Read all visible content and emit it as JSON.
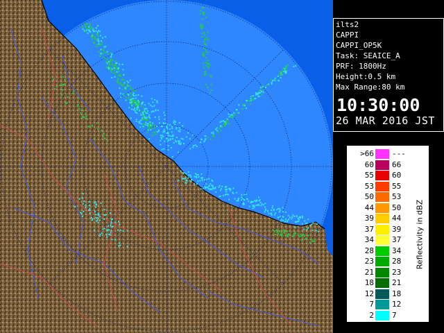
{
  "info": {
    "lines": [
      "ilts2",
      "CAPPI",
      "CAPPI_OP5K",
      "Task: SEAICE_A",
      "PRF: 1800Hz",
      "Height:0.5 km",
      "Max Range:80 km"
    ],
    "time": "10:30:00",
    "date": "26 MAR 2016 JST"
  },
  "legend": {
    "title": "Reflectivity in dBZ",
    "rows": [
      {
        "lo": ">66",
        "hi": "---",
        "color": "#ff33ff"
      },
      {
        "lo": "60",
        "hi": "66",
        "color": "#b8005c"
      },
      {
        "lo": "55",
        "hi": "60",
        "color": "#e60000"
      },
      {
        "lo": "53",
        "hi": "55",
        "color": "#ff3b00"
      },
      {
        "lo": "50",
        "hi": "53",
        "color": "#ff6a00"
      },
      {
        "lo": "44",
        "hi": "50",
        "color": "#ff9900"
      },
      {
        "lo": "39",
        "hi": "44",
        "color": "#ffcc00"
      },
      {
        "lo": "37",
        "hi": "39",
        "color": "#ffee00"
      },
      {
        "lo": "34",
        "hi": "37",
        "color": "#ffff33"
      },
      {
        "lo": "28",
        "hi": "34",
        "color": "#00cc00"
      },
      {
        "lo": "23",
        "hi": "28",
        "color": "#00aa00"
      },
      {
        "lo": "21",
        "hi": "23",
        "color": "#008800"
      },
      {
        "lo": "18",
        "hi": "21",
        "color": "#006e00"
      },
      {
        "lo": "12",
        "hi": "18",
        "color": "#005c5c"
      },
      {
        "lo": "7",
        "hi": "12",
        "color": "#009999"
      },
      {
        "lo": "2",
        "hi": "7",
        "color": "#00ffff"
      }
    ]
  },
  "colors": {
    "ocean": "#0a5fe8",
    "radar_cover": "#2f87ff",
    "land": "#7a5f3c",
    "land_dark": "#4a3620",
    "land_light": "#b49668",
    "river": "#4a5ad0",
    "boundary": "#c84a4a",
    "echo_green": "#22cc44",
    "echo_cyan": "#33e6e6"
  }
}
